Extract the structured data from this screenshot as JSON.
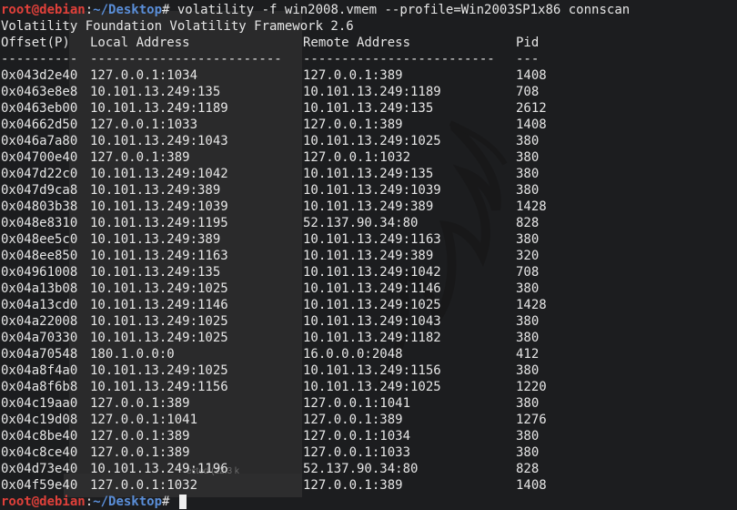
{
  "prompt": {
    "user_host": "root@debian",
    "colon": ":",
    "path": "~/Desktop",
    "hash": "#"
  },
  "command": " volatility -f win2008.vmem --profile=Win2003SP1x86 connscan",
  "banner": "Volatility Foundation Volatility Framework 2.6",
  "table": {
    "headers": [
      "Offset(P)",
      "Local Address",
      "Remote Address",
      "Pid"
    ],
    "separators": [
      "----------",
      "-------------------------",
      "-------------------------",
      "---"
    ],
    "rows": [
      [
        "0x043d2e40",
        "127.0.0.1:1034",
        "127.0.0.1:389",
        "1408"
      ],
      [
        "0x0463e8e8",
        "10.101.13.249:135",
        "10.101.13.249:1189",
        "708"
      ],
      [
        "0x0463eb00",
        "10.101.13.249:1189",
        "10.101.13.249:135",
        "2612"
      ],
      [
        "0x04662d50",
        "127.0.0.1:1033",
        "127.0.0.1:389",
        "1408"
      ],
      [
        "0x046a7a80",
        "10.101.13.249:1043",
        "10.101.13.249:1025",
        "380"
      ],
      [
        "0x04700e40",
        "127.0.0.1:389",
        "127.0.0.1:1032",
        "380"
      ],
      [
        "0x047d22c0",
        "10.101.13.249:1042",
        "10.101.13.249:135",
        "380"
      ],
      [
        "0x047d9ca8",
        "10.101.13.249:389",
        "10.101.13.249:1039",
        "380"
      ],
      [
        "0x04803b38",
        "10.101.13.249:1039",
        "10.101.13.249:389",
        "1428"
      ],
      [
        "0x048e8310",
        "10.101.13.249:1195",
        "52.137.90.34:80",
        "828"
      ],
      [
        "0x048ee5c0",
        "10.101.13.249:389",
        "10.101.13.249:1163",
        "380"
      ],
      [
        "0x048ee850",
        "10.101.13.249:1163",
        "10.101.13.249:389",
        "320"
      ],
      [
        "0x04961008",
        "10.101.13.249:135",
        "10.101.13.249:1042",
        "708"
      ],
      [
        "0x04a13b08",
        "10.101.13.249:1025",
        "10.101.13.249:1146",
        "380"
      ],
      [
        "0x04a13cd0",
        "10.101.13.249:1146",
        "10.101.13.249:1025",
        "1428"
      ],
      [
        "0x04a22008",
        "10.101.13.249:1025",
        "10.101.13.249:1043",
        "380"
      ],
      [
        "0x04a70330",
        "10.101.13.249:1025",
        "10.101.13.249:1182",
        "380"
      ],
      [
        "0x04a70548",
        "180.1.0.0:0",
        "16.0.0.0:2048",
        "412"
      ],
      [
        "0x04a8f4a0",
        "10.101.13.249:1025",
        "10.101.13.249:1156",
        "380"
      ],
      [
        "0x04a8f6b8",
        "10.101.13.249:1156",
        "10.101.13.249:1025",
        "1220"
      ],
      [
        "0x04c19aa0",
        "127.0.0.1:389",
        "127.0.0.1:1041",
        "380"
      ],
      [
        "0x04c19d08",
        "127.0.0.1:1041",
        "127.0.0.1:389",
        "1276"
      ],
      [
        "0x04c8be40",
        "127.0.0.1:389",
        "127.0.0.1:1034",
        "380"
      ],
      [
        "0x04c8ce40",
        "127.0.0.1:389",
        "127.0.0.1:1033",
        "380"
      ],
      [
        "0x04d73e40",
        "10.101.13.249:1196",
        "52.137.90.34:80",
        "828"
      ],
      [
        "0x04f59e40",
        "127.0.0.1:1032",
        "127.0.0.1:389",
        "1408"
      ]
    ]
  },
  "background_ghost_text": "ected (12.3 k",
  "colors": {
    "background": "#1c1d1f",
    "text": "#e6e6e6",
    "prompt_user": "#e0403a",
    "prompt_path": "#5a8ed8"
  }
}
